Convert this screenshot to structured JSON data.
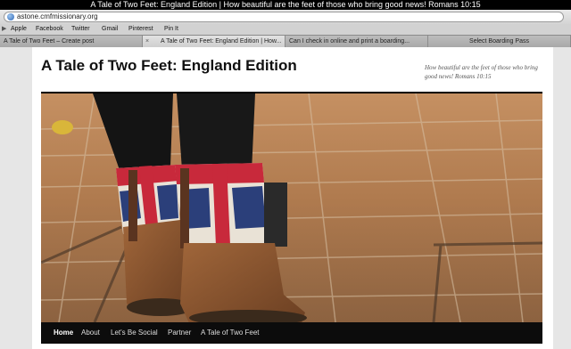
{
  "window": {
    "title": "A Tale of Two Feet: England Edition | How beautiful are the feet of those who bring good news! Romans 10:15"
  },
  "address_bar": {
    "url": "astone.cmfmissionary.org"
  },
  "bookmarks": [
    "Apple",
    "Facebook",
    "Twitter",
    "Gmail",
    "Pinterest",
    "Pin It"
  ],
  "tabs": [
    {
      "label": "A Tale of Two Feet – Create post"
    },
    {
      "label": "A Tale of Two Feet: England Edition | How..."
    },
    {
      "label": "Can I check in online and print a boarding..."
    },
    {
      "label": "Select Boarding Pass"
    }
  ],
  "site": {
    "title": "A Tale of Two Feet: England Edition",
    "description": "How beautiful are the feet of those who bring good news! Romans 10:15"
  },
  "nav": [
    "Home",
    "About",
    "Let's Be Social",
    "Partner",
    "A Tale of Two Feet"
  ],
  "colors": {
    "nav_bg": "#0c0c0c",
    "header_rule": "#000000",
    "tab_active": "#d9d9d9"
  }
}
